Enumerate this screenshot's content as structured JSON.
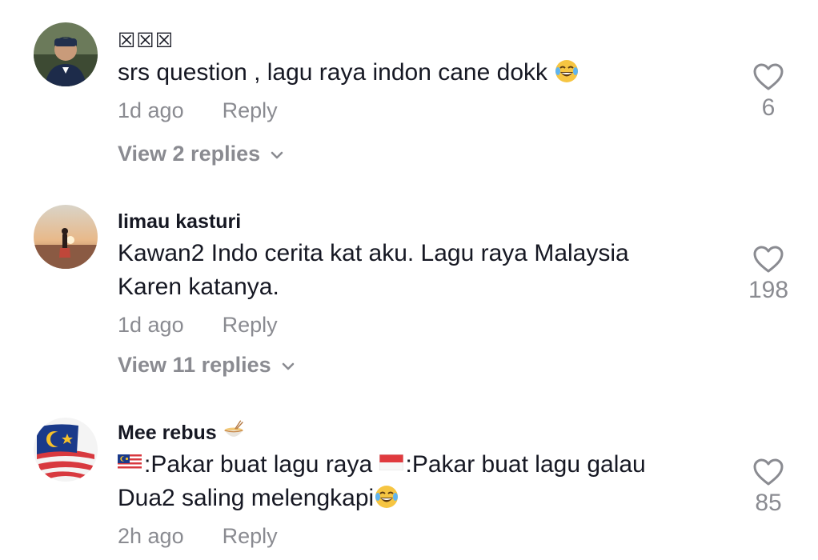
{
  "comments": [
    {
      "username": "☒☒☒",
      "text_lines": [
        "srs question , lagu raya indon cane dokk"
      ],
      "time": "1d ago",
      "reply_label": "Reply",
      "view_replies": "View 2 replies",
      "likes": "6"
    },
    {
      "username": "limau kasturi",
      "text_lines": [
        "Kawan2 Indo cerita kat aku. Lagu raya Malaysia",
        "Karen katanya."
      ],
      "time": "1d ago",
      "reply_label": "Reply",
      "view_replies": "View 11 replies",
      "likes": "198"
    },
    {
      "username": "Mee rebus",
      "text_parts": [
        ":Pakar buat lagu raya ",
        ":Pakar buat lagu galau"
      ],
      "text_line2": "Dua2 saling melengkapi",
      "time": "2h ago",
      "reply_label": "Reply",
      "likes": "85"
    }
  ],
  "icons": {
    "like": "heart-outline-icon",
    "expand": "chevron-down-icon",
    "laugh": "tears-of-joy-emoji",
    "noodles": "noodle-bowl-emoji",
    "flag_my": "malaysia-flag-emoji",
    "flag_id": "indonesia-flag-emoji"
  },
  "colors": {
    "text": "#161823",
    "secondary": "#8a8b91",
    "background": "#ffffff"
  }
}
